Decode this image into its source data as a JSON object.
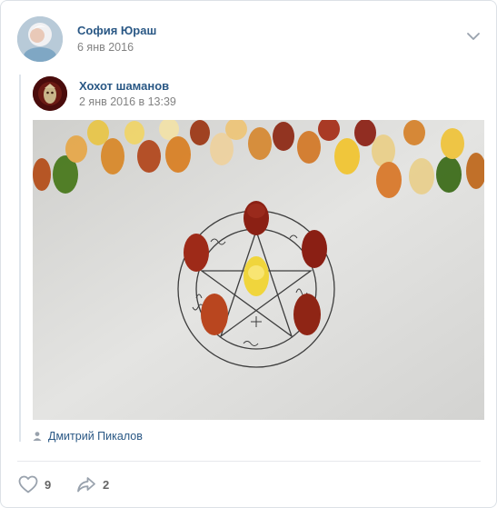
{
  "post": {
    "author": "София Юраш",
    "date": "6 янв 2016"
  },
  "repost": {
    "group": "Хохот шаманов",
    "date": "2 янв 2016 в 13:39",
    "signer": "Дмитрий Пикалов"
  },
  "actions": {
    "likes": "9",
    "shares": "2"
  },
  "icons": {
    "menu": "chevron-down-icon",
    "signer": "person-icon",
    "like": "heart-icon",
    "share": "share-arrow-icon"
  },
  "colors": {
    "link": "#2a5885",
    "muted": "#828282",
    "icon": "#99a2ad",
    "border": "#dce1e6"
  }
}
